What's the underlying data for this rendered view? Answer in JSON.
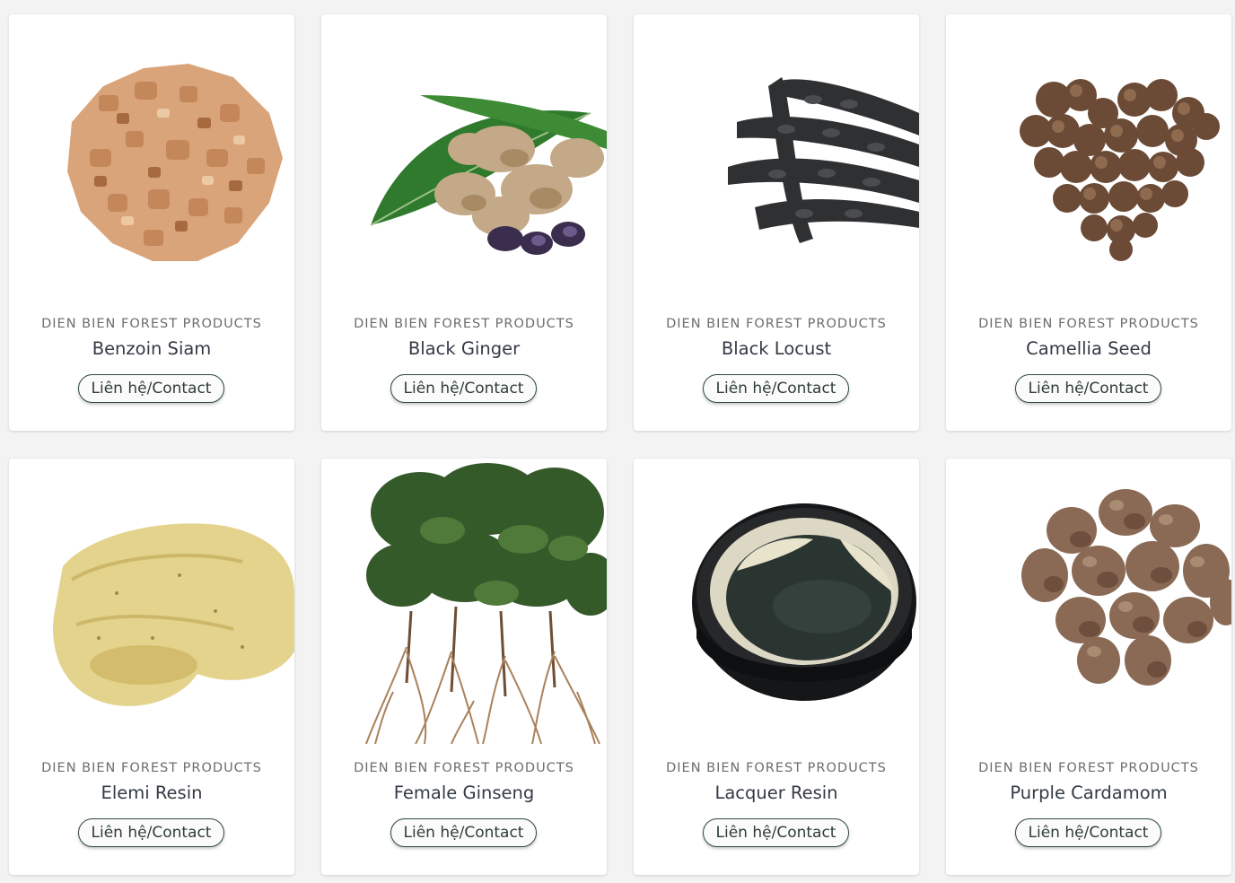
{
  "products": [
    {
      "category": "DIEN BIEN FOREST PRODUCTS",
      "name": "Benzoin Siam",
      "cta": "Liên hệ/Contact",
      "image": "benzoin-resin-chunks"
    },
    {
      "category": "DIEN BIEN FOREST PRODUCTS",
      "name": "Black Ginger",
      "cta": "Liên hệ/Contact",
      "image": "black-ginger-rhizome"
    },
    {
      "category": "DIEN BIEN FOREST PRODUCTS",
      "name": "Black Locust",
      "cta": "Liên hệ/Contact",
      "image": "black-locust-pods"
    },
    {
      "category": "DIEN BIEN FOREST PRODUCTS",
      "name": "Camellia Seed",
      "cta": "Liên hệ/Contact",
      "image": "camellia-seeds-heart"
    },
    {
      "category": "DIEN BIEN FOREST PRODUCTS",
      "name": "Elemi Resin",
      "cta": "Liên hệ/Contact",
      "image": "elemi-resin-lump"
    },
    {
      "category": "DIEN BIEN FOREST PRODUCTS",
      "name": "Female Ginseng",
      "cta": "Liên hệ/Contact",
      "image": "female-ginseng-plants"
    },
    {
      "category": "DIEN BIEN FOREST PRODUCTS",
      "name": "Lacquer Resin",
      "cta": "Liên hệ/Contact",
      "image": "lacquer-resin-bowl"
    },
    {
      "category": "DIEN BIEN FOREST PRODUCTS",
      "name": "Purple Cardamom",
      "cta": "Liên hệ/Contact",
      "image": "purple-cardamom-pods"
    }
  ],
  "colors": {
    "page_bg": "#f3f3f3",
    "card_bg": "#ffffff",
    "button_border": "#2f4a3b",
    "name_text": "#333a45",
    "category_text": "#6d6d6d"
  }
}
